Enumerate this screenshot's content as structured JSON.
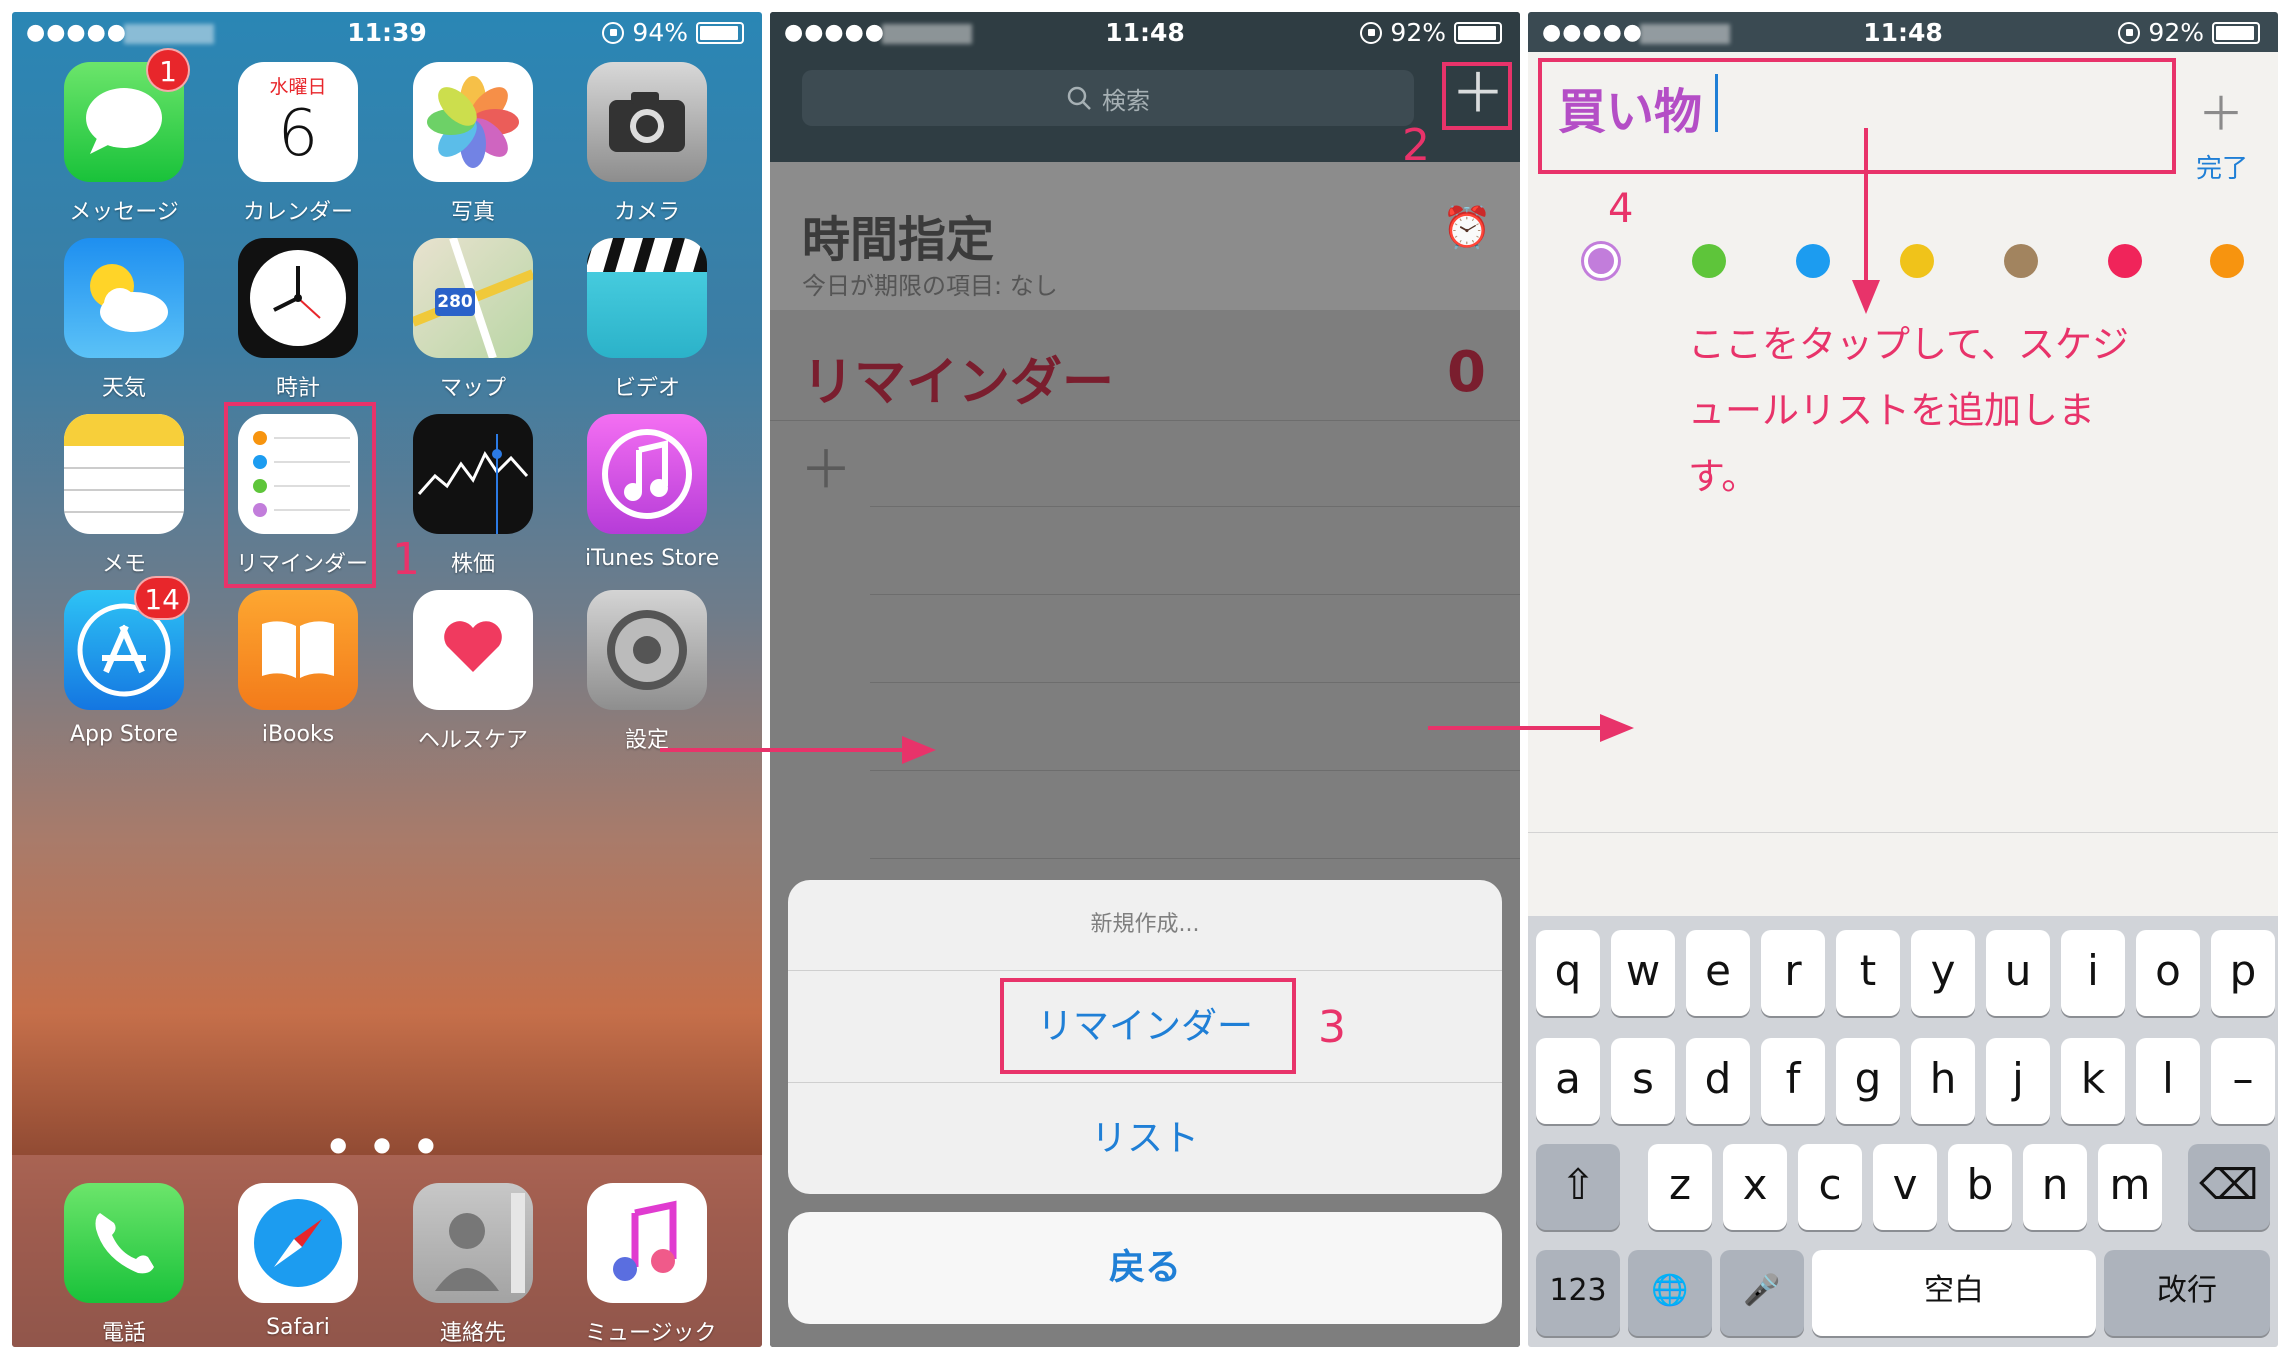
{
  "panel1": {
    "status": {
      "dots": "●●●●●",
      "time": "11:39",
      "battery": "94%"
    },
    "apps": [
      {
        "label": "メッセージ",
        "icon": "messages-icon",
        "badge": "1"
      },
      {
        "label": "カレンダー",
        "icon": "calendar-icon",
        "weekday": "水曜日",
        "day": "6"
      },
      {
        "label": "写真",
        "icon": "photos-icon"
      },
      {
        "label": "カメラ",
        "icon": "camera-icon"
      },
      {
        "label": "天気",
        "icon": "weather-icon"
      },
      {
        "label": "時計",
        "icon": "clock-icon"
      },
      {
        "label": "マップ",
        "icon": "maps-icon",
        "sign": "280"
      },
      {
        "label": "ビデオ",
        "icon": "videos-icon"
      },
      {
        "label": "メモ",
        "icon": "notes-icon"
      },
      {
        "label": "リマインダー",
        "icon": "reminders-icon"
      },
      {
        "label": "株価",
        "icon": "stocks-icon"
      },
      {
        "label": "iTunes Store",
        "icon": "itunes-icon"
      },
      {
        "label": "App Store",
        "icon": "appstore-icon",
        "badge": "14"
      },
      {
        "label": "iBooks",
        "icon": "ibooks-icon"
      },
      {
        "label": "ヘルスケア",
        "icon": "health-icon"
      },
      {
        "label": "設定",
        "icon": "settings-icon"
      }
    ],
    "dock": [
      {
        "label": "電話",
        "icon": "phone-icon"
      },
      {
        "label": "Safari",
        "icon": "safari-icon"
      },
      {
        "label": "連絡先",
        "icon": "contacts-icon"
      },
      {
        "label": "ミュージック",
        "icon": "music-icon"
      }
    ],
    "step_number": "1"
  },
  "panel2": {
    "status": {
      "dots": "●●●●●",
      "time": "11:48",
      "battery": "92%"
    },
    "search_placeholder": "検索",
    "step_plus": "2",
    "scheduled": {
      "title": "時間指定",
      "subtitle": "今日が期限の項目: なし"
    },
    "reminders": {
      "title": "リマインダー",
      "count": "0"
    },
    "sheet": {
      "header": "新規作成...",
      "option_reminder": "リマインダー",
      "option_list": "リスト",
      "cancel": "戻る"
    },
    "step_sheet": "3"
  },
  "panel3": {
    "status": {
      "dots": "●●●●●",
      "time": "11:48",
      "battery": "92%"
    },
    "list_name": "買い物",
    "done": "完了",
    "step_title": "4",
    "colors": [
      "#c27ddb",
      "#5ec53a",
      "#1c9cf0",
      "#f0c31a",
      "#a2845f",
      "#f0245a",
      "#f7940f"
    ],
    "note": "ここをタップして、スケジュールリストを追加します。",
    "keyboard": {
      "row1": [
        "q",
        "w",
        "e",
        "r",
        "t",
        "y",
        "u",
        "i",
        "o",
        "p"
      ],
      "row2": [
        "a",
        "s",
        "d",
        "f",
        "g",
        "h",
        "j",
        "k",
        "l",
        "–"
      ],
      "row3": [
        "z",
        "x",
        "c",
        "v",
        "b",
        "n",
        "m"
      ],
      "num": "123",
      "space": "空白",
      "return": "改行"
    }
  },
  "accent": "#e8336a"
}
